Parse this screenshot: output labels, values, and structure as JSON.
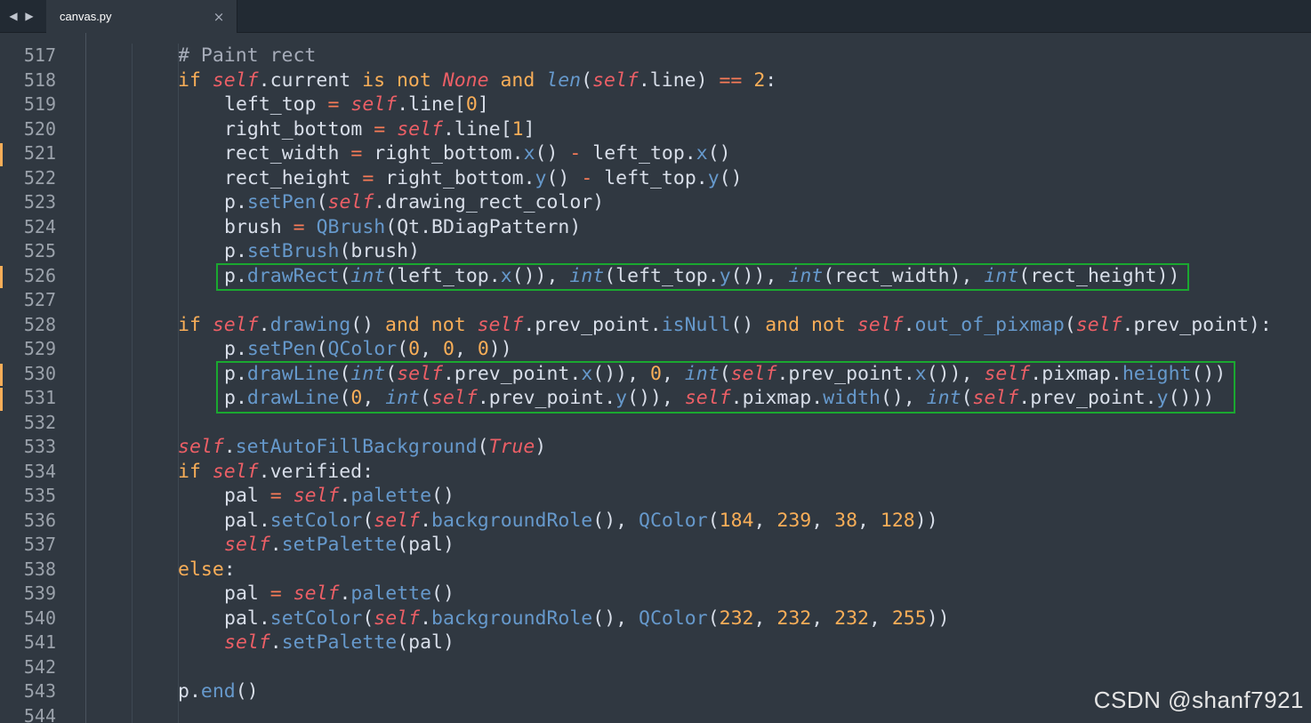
{
  "tab": {
    "title": "canvas.py",
    "close_glyph": "×",
    "nav_back_glyph": "◀",
    "nav_forward_glyph": "▶"
  },
  "colors": {
    "background": "#303841",
    "keyword": "#f9ae58",
    "self": "#ec5f66",
    "builtin": "#6699cc",
    "number": "#f9ae58",
    "highlight_box": "#1aa830",
    "modified_marker": "#f9ae58"
  },
  "icons": {
    "nav_back": "triangle-left-icon",
    "nav_forward": "triangle-right-icon",
    "close": "close-icon"
  },
  "editor": {
    "modified_lines": [
      521,
      526,
      530,
      531
    ],
    "highlighted_ranges": [
      [
        526,
        526
      ],
      [
        530,
        531
      ]
    ],
    "lines": [
      {
        "num": "517",
        "indent": 2,
        "tokens": [
          [
            "comment",
            "# Paint rect"
          ]
        ]
      },
      {
        "num": "518",
        "indent": 2,
        "tokens": [
          [
            "kw",
            "if"
          ],
          [
            "plain",
            " "
          ],
          [
            "self",
            "self"
          ],
          [
            "plain",
            ".current "
          ],
          [
            "kw",
            "is not"
          ],
          [
            "plain",
            " "
          ],
          [
            "const",
            "None"
          ],
          [
            "plain",
            " "
          ],
          [
            "kw",
            "and"
          ],
          [
            "plain",
            " "
          ],
          [
            "builtin",
            "len"
          ],
          [
            "plain",
            "("
          ],
          [
            "self",
            "self"
          ],
          [
            "plain",
            ".line) "
          ],
          [
            "op",
            "=="
          ],
          [
            "plain",
            " "
          ],
          [
            "num",
            "2"
          ],
          [
            "plain",
            ":"
          ]
        ]
      },
      {
        "num": "519",
        "indent": 3,
        "tokens": [
          [
            "plain",
            "left_top "
          ],
          [
            "op",
            "="
          ],
          [
            "plain",
            " "
          ],
          [
            "self",
            "self"
          ],
          [
            "plain",
            ".line["
          ],
          [
            "num",
            "0"
          ],
          [
            "plain",
            "]"
          ]
        ]
      },
      {
        "num": "520",
        "indent": 3,
        "tokens": [
          [
            "plain",
            "right_bottom "
          ],
          [
            "op",
            "="
          ],
          [
            "plain",
            " "
          ],
          [
            "self",
            "self"
          ],
          [
            "plain",
            ".line["
          ],
          [
            "num",
            "1"
          ],
          [
            "plain",
            "]"
          ]
        ]
      },
      {
        "num": "521",
        "indent": 3,
        "tokens": [
          [
            "plain",
            "rect_width "
          ],
          [
            "op",
            "="
          ],
          [
            "plain",
            " right_bottom."
          ],
          [
            "func",
            "x"
          ],
          [
            "plain",
            "() "
          ],
          [
            "op",
            "-"
          ],
          [
            "plain",
            " left_top."
          ],
          [
            "func",
            "x"
          ],
          [
            "plain",
            "()"
          ]
        ]
      },
      {
        "num": "522",
        "indent": 3,
        "tokens": [
          [
            "plain",
            "rect_height "
          ],
          [
            "op",
            "="
          ],
          [
            "plain",
            " right_bottom."
          ],
          [
            "func",
            "y"
          ],
          [
            "plain",
            "() "
          ],
          [
            "op",
            "-"
          ],
          [
            "plain",
            " left_top."
          ],
          [
            "func",
            "y"
          ],
          [
            "plain",
            "()"
          ]
        ]
      },
      {
        "num": "523",
        "indent": 3,
        "tokens": [
          [
            "plain",
            "p."
          ],
          [
            "func",
            "setPen"
          ],
          [
            "plain",
            "("
          ],
          [
            "self",
            "self"
          ],
          [
            "plain",
            ".drawing_rect_color)"
          ]
        ]
      },
      {
        "num": "524",
        "indent": 3,
        "tokens": [
          [
            "plain",
            "brush "
          ],
          [
            "op",
            "="
          ],
          [
            "plain",
            " "
          ],
          [
            "func",
            "QBrush"
          ],
          [
            "plain",
            "(Qt.BDiagPattern)"
          ]
        ]
      },
      {
        "num": "525",
        "indent": 3,
        "tokens": [
          [
            "plain",
            "p."
          ],
          [
            "func",
            "setBrush"
          ],
          [
            "plain",
            "(brush)"
          ]
        ]
      },
      {
        "num": "526",
        "indent": 3,
        "tokens": [
          [
            "plain",
            "p."
          ],
          [
            "func",
            "drawRect"
          ],
          [
            "plain",
            "("
          ],
          [
            "builtin",
            "int"
          ],
          [
            "plain",
            "(left_top."
          ],
          [
            "func",
            "x"
          ],
          [
            "plain",
            "()), "
          ],
          [
            "builtin",
            "int"
          ],
          [
            "plain",
            "(left_top."
          ],
          [
            "func",
            "y"
          ],
          [
            "plain",
            "()), "
          ],
          [
            "builtin",
            "int"
          ],
          [
            "plain",
            "(rect_width), "
          ],
          [
            "builtin",
            "int"
          ],
          [
            "plain",
            "(rect_height))"
          ]
        ]
      },
      {
        "num": "527",
        "indent": 0,
        "tokens": []
      },
      {
        "num": "528",
        "indent": 2,
        "tokens": [
          [
            "kw",
            "if"
          ],
          [
            "plain",
            " "
          ],
          [
            "self",
            "self"
          ],
          [
            "plain",
            "."
          ],
          [
            "func",
            "drawing"
          ],
          [
            "plain",
            "() "
          ],
          [
            "kw",
            "and not"
          ],
          [
            "plain",
            " "
          ],
          [
            "self",
            "self"
          ],
          [
            "plain",
            ".prev_point."
          ],
          [
            "func",
            "isNull"
          ],
          [
            "plain",
            "() "
          ],
          [
            "kw",
            "and not"
          ],
          [
            "plain",
            " "
          ],
          [
            "self",
            "self"
          ],
          [
            "plain",
            "."
          ],
          [
            "func",
            "out_of_pixmap"
          ],
          [
            "plain",
            "("
          ],
          [
            "self",
            "self"
          ],
          [
            "plain",
            ".prev_point):"
          ]
        ]
      },
      {
        "num": "529",
        "indent": 3,
        "tokens": [
          [
            "plain",
            "p."
          ],
          [
            "func",
            "setPen"
          ],
          [
            "plain",
            "("
          ],
          [
            "func",
            "QColor"
          ],
          [
            "plain",
            "("
          ],
          [
            "num",
            "0"
          ],
          [
            "plain",
            ", "
          ],
          [
            "num",
            "0"
          ],
          [
            "plain",
            ", "
          ],
          [
            "num",
            "0"
          ],
          [
            "plain",
            "))"
          ]
        ]
      },
      {
        "num": "530",
        "indent": 3,
        "tokens": [
          [
            "plain",
            "p."
          ],
          [
            "func",
            "drawLine"
          ],
          [
            "plain",
            "("
          ],
          [
            "builtin",
            "int"
          ],
          [
            "plain",
            "("
          ],
          [
            "self",
            "self"
          ],
          [
            "plain",
            ".prev_point."
          ],
          [
            "func",
            "x"
          ],
          [
            "plain",
            "()), "
          ],
          [
            "num",
            "0"
          ],
          [
            "plain",
            ", "
          ],
          [
            "builtin",
            "int"
          ],
          [
            "plain",
            "("
          ],
          [
            "self",
            "self"
          ],
          [
            "plain",
            ".prev_point."
          ],
          [
            "func",
            "x"
          ],
          [
            "plain",
            "()), "
          ],
          [
            "self",
            "self"
          ],
          [
            "plain",
            ".pixmap."
          ],
          [
            "func",
            "height"
          ],
          [
            "plain",
            "())"
          ]
        ]
      },
      {
        "num": "531",
        "indent": 3,
        "tokens": [
          [
            "plain",
            "p."
          ],
          [
            "func",
            "drawLine"
          ],
          [
            "plain",
            "("
          ],
          [
            "num",
            "0"
          ],
          [
            "plain",
            ", "
          ],
          [
            "builtin",
            "int"
          ],
          [
            "plain",
            "("
          ],
          [
            "self",
            "self"
          ],
          [
            "plain",
            ".prev_point."
          ],
          [
            "func",
            "y"
          ],
          [
            "plain",
            "()), "
          ],
          [
            "self",
            "self"
          ],
          [
            "plain",
            ".pixmap."
          ],
          [
            "func",
            "width"
          ],
          [
            "plain",
            "(), "
          ],
          [
            "builtin",
            "int"
          ],
          [
            "plain",
            "("
          ],
          [
            "self",
            "self"
          ],
          [
            "plain",
            ".prev_point."
          ],
          [
            "func",
            "y"
          ],
          [
            "plain",
            "()))"
          ]
        ]
      },
      {
        "num": "532",
        "indent": 0,
        "tokens": []
      },
      {
        "num": "533",
        "indent": 2,
        "tokens": [
          [
            "self",
            "self"
          ],
          [
            "plain",
            "."
          ],
          [
            "func",
            "setAutoFillBackground"
          ],
          [
            "plain",
            "("
          ],
          [
            "const",
            "True"
          ],
          [
            "plain",
            ")"
          ]
        ]
      },
      {
        "num": "534",
        "indent": 2,
        "tokens": [
          [
            "kw",
            "if"
          ],
          [
            "plain",
            " "
          ],
          [
            "self",
            "self"
          ],
          [
            "plain",
            ".verified:"
          ]
        ]
      },
      {
        "num": "535",
        "indent": 3,
        "tokens": [
          [
            "plain",
            "pal "
          ],
          [
            "op",
            "="
          ],
          [
            "plain",
            " "
          ],
          [
            "self",
            "self"
          ],
          [
            "plain",
            "."
          ],
          [
            "func",
            "palette"
          ],
          [
            "plain",
            "()"
          ]
        ]
      },
      {
        "num": "536",
        "indent": 3,
        "tokens": [
          [
            "plain",
            "pal."
          ],
          [
            "func",
            "setColor"
          ],
          [
            "plain",
            "("
          ],
          [
            "self",
            "self"
          ],
          [
            "plain",
            "."
          ],
          [
            "func",
            "backgroundRole"
          ],
          [
            "plain",
            "(), "
          ],
          [
            "func",
            "QColor"
          ],
          [
            "plain",
            "("
          ],
          [
            "num",
            "184"
          ],
          [
            "plain",
            ", "
          ],
          [
            "num",
            "239"
          ],
          [
            "plain",
            ", "
          ],
          [
            "num",
            "38"
          ],
          [
            "plain",
            ", "
          ],
          [
            "num",
            "128"
          ],
          [
            "plain",
            "))"
          ]
        ]
      },
      {
        "num": "537",
        "indent": 3,
        "tokens": [
          [
            "self",
            "self"
          ],
          [
            "plain",
            "."
          ],
          [
            "func",
            "setPalette"
          ],
          [
            "plain",
            "(pal)"
          ]
        ]
      },
      {
        "num": "538",
        "indent": 2,
        "tokens": [
          [
            "kw",
            "else"
          ],
          [
            "plain",
            ":"
          ]
        ]
      },
      {
        "num": "539",
        "indent": 3,
        "tokens": [
          [
            "plain",
            "pal "
          ],
          [
            "op",
            "="
          ],
          [
            "plain",
            " "
          ],
          [
            "self",
            "self"
          ],
          [
            "plain",
            "."
          ],
          [
            "func",
            "palette"
          ],
          [
            "plain",
            "()"
          ]
        ]
      },
      {
        "num": "540",
        "indent": 3,
        "tokens": [
          [
            "plain",
            "pal."
          ],
          [
            "func",
            "setColor"
          ],
          [
            "plain",
            "("
          ],
          [
            "self",
            "self"
          ],
          [
            "plain",
            "."
          ],
          [
            "func",
            "backgroundRole"
          ],
          [
            "plain",
            "(), "
          ],
          [
            "func",
            "QColor"
          ],
          [
            "plain",
            "("
          ],
          [
            "num",
            "232"
          ],
          [
            "plain",
            ", "
          ],
          [
            "num",
            "232"
          ],
          [
            "plain",
            ", "
          ],
          [
            "num",
            "232"
          ],
          [
            "plain",
            ", "
          ],
          [
            "num",
            "255"
          ],
          [
            "plain",
            "))"
          ]
        ]
      },
      {
        "num": "541",
        "indent": 3,
        "tokens": [
          [
            "self",
            "self"
          ],
          [
            "plain",
            "."
          ],
          [
            "func",
            "setPalette"
          ],
          [
            "plain",
            "(pal)"
          ]
        ]
      },
      {
        "num": "542",
        "indent": 0,
        "tokens": []
      },
      {
        "num": "543",
        "indent": 2,
        "tokens": [
          [
            "plain",
            "p."
          ],
          [
            "func",
            "end"
          ],
          [
            "plain",
            "()"
          ]
        ]
      },
      {
        "num": "544",
        "indent": 0,
        "tokens": []
      }
    ]
  },
  "watermark": "CSDN @shanf7921"
}
